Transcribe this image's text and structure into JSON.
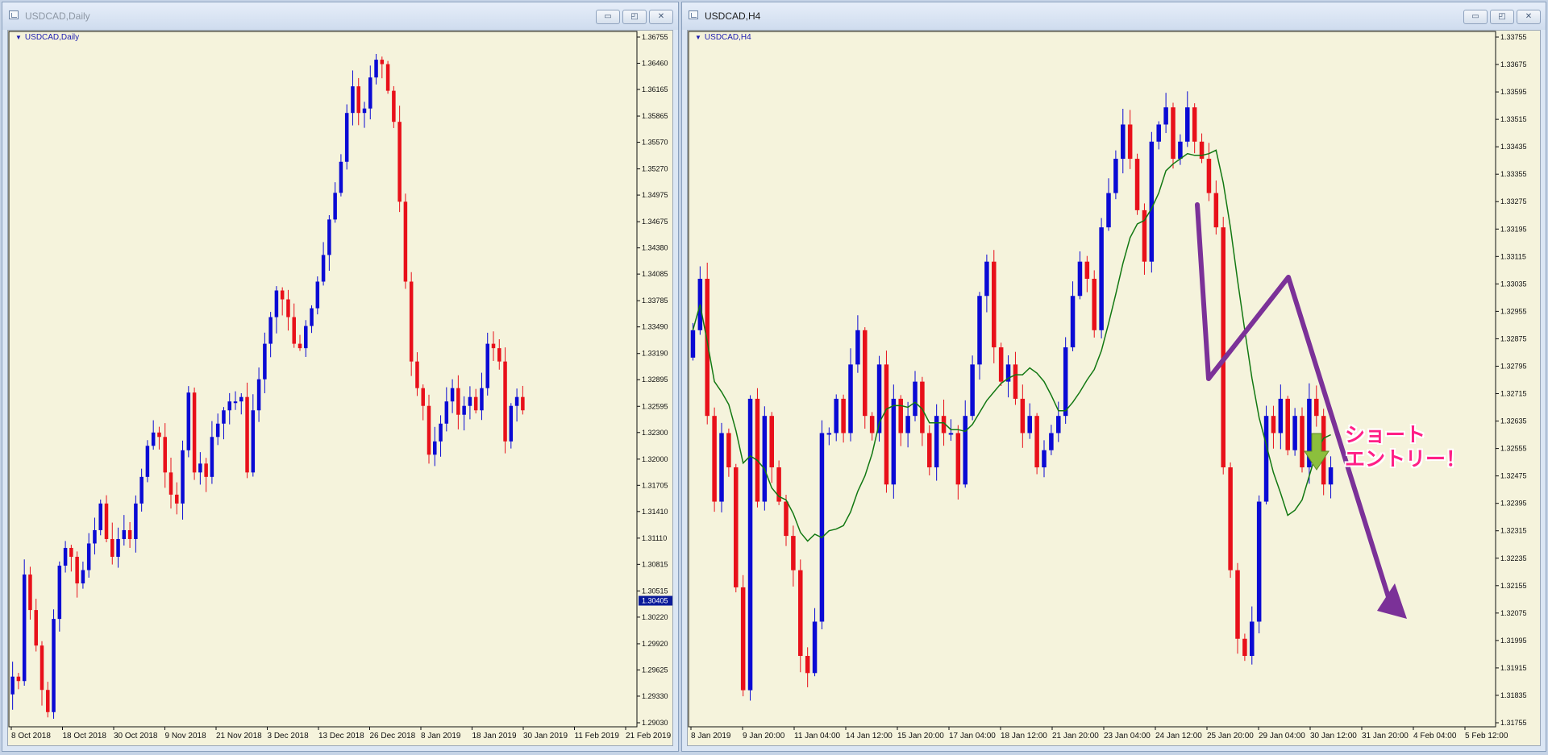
{
  "windows": [
    {
      "title": "USDCAD,Daily",
      "chart_label": "USDCAD,Daily",
      "buttons": {
        "minimize": "▭",
        "restore": "◰",
        "close": "✕"
      }
    },
    {
      "title": "USDCAD,H4",
      "chart_label": "USDCAD,H4",
      "buttons": {
        "minimize": "▭",
        "restore": "◰",
        "close": "✕"
      }
    }
  ],
  "colors": {
    "background": "#f5f3dc",
    "bull": "#0a0ad4",
    "bear": "#e8101a",
    "moving_average": "#127812",
    "annotation_arrow": "#7b3198",
    "entry_arrow": "#8cbf3c",
    "annotation_text": "#ff1f86"
  },
  "annotation": {
    "lines": [
      "ショート",
      "エントリー！"
    ],
    "icon": "down-arrow-icon"
  },
  "chart_data": [
    {
      "type": "candlestick",
      "symbol": "USDCAD",
      "timeframe": "Daily",
      "ylim": [
        1.2903,
        1.36755
      ],
      "y_ticks": [
        "1.36755",
        "1.36460",
        "1.36165",
        "1.35865",
        "1.35570",
        "1.35270",
        "1.34975",
        "1.34675",
        "1.34380",
        "1.34085",
        "1.33785",
        "1.33490",
        "1.33190",
        "1.32895",
        "1.32595",
        "1.32300",
        "1.32000",
        "1.31705",
        "1.31410",
        "1.31110",
        "1.30815",
        "1.30515",
        "1.30220",
        "1.29920",
        "1.29625",
        "1.29330",
        "1.29030"
      ],
      "current_price": "1.30405",
      "x_labels": [
        "8 Oct 2018",
        "18 Oct 2018",
        "30 Oct 2018",
        "9 Nov 2018",
        "21 Nov 2018",
        "3 Dec 2018",
        "13 Dec 2018",
        "26 Dec 2018",
        "8 Jan 2019",
        "18 Jan 2019",
        "30 Jan 2019",
        "11 Feb 2019",
        "21 Feb 2019"
      ],
      "closes": [
        1.2955,
        1.295,
        1.307,
        1.303,
        1.299,
        1.294,
        1.2915,
        1.302,
        1.308,
        1.31,
        1.309,
        1.306,
        1.3075,
        1.3105,
        1.312,
        1.315,
        1.311,
        1.309,
        1.311,
        1.312,
        1.311,
        1.315,
        1.318,
        1.3215,
        1.323,
        1.3225,
        1.3185,
        1.316,
        1.315,
        1.321,
        1.3275,
        1.3185,
        1.3195,
        1.318,
        1.3225,
        1.324,
        1.3255,
        1.3265,
        1.3265,
        1.327,
        1.3185,
        1.3255,
        1.329,
        1.333,
        1.336,
        1.339,
        1.338,
        1.336,
        1.333,
        1.3325,
        1.335,
        1.337,
        1.34,
        1.343,
        1.347,
        1.35,
        1.3535,
        1.359,
        1.362,
        1.359,
        1.3595,
        1.363,
        1.365,
        1.3645,
        1.3615,
        1.358,
        1.349,
        1.34,
        1.331,
        1.328,
        1.326,
        1.3205,
        1.322,
        1.324,
        1.3265,
        1.328,
        1.325,
        1.326,
        1.327,
        1.3255,
        1.328,
        1.333,
        1.3325,
        1.331,
        1.322,
        1.326,
        1.327,
        1.3255
      ],
      "indicator": null
    },
    {
      "type": "candlestick",
      "symbol": "USDCAD",
      "timeframe": "H4",
      "ylim": [
        1.31755,
        1.33755
      ],
      "y_ticks": [
        "1.33755",
        "1.33675",
        "1.33595",
        "1.33515",
        "1.33435",
        "1.33355",
        "1.33275",
        "1.33195",
        "1.33115",
        "1.33035",
        "1.32955",
        "1.32875",
        "1.32795",
        "1.32715",
        "1.32635",
        "1.32555",
        "1.32475",
        "1.32395",
        "1.32315",
        "1.32235",
        "1.32155",
        "1.32075",
        "1.31995",
        "1.31915",
        "1.31835",
        "1.31755"
      ],
      "x_labels": [
        "8 Jan 2019",
        "9 Jan 20:00",
        "11 Jan 04:00",
        "14 Jan 12:00",
        "15 Jan 20:00",
        "17 Jan 04:00",
        "18 Jan 12:00",
        "21 Jan 20:00",
        "23 Jan 04:00",
        "24 Jan 12:00",
        "25 Jan 20:00",
        "29 Jan 04:00",
        "30 Jan 12:00",
        "31 Jan 20:00",
        "4 Feb 04:00",
        "5 Feb 12:00"
      ],
      "closes": [
        1.329,
        1.3305,
        1.3265,
        1.324,
        1.326,
        1.325,
        1.3215,
        1.3185,
        1.327,
        1.324,
        1.3265,
        1.325,
        1.324,
        1.323,
        1.322,
        1.3195,
        1.319,
        1.3205,
        1.326,
        1.326,
        1.327,
        1.326,
        1.328,
        1.329,
        1.3265,
        1.326,
        1.328,
        1.3245,
        1.327,
        1.326,
        1.3265,
        1.3275,
        1.326,
        1.325,
        1.3265,
        1.326,
        1.326,
        1.3245,
        1.3265,
        1.328,
        1.33,
        1.331,
        1.3285,
        1.3275,
        1.328,
        1.327,
        1.326,
        1.3265,
        1.325,
        1.3255,
        1.326,
        1.3265,
        1.3285,
        1.33,
        1.331,
        1.3305,
        1.329,
        1.332,
        1.333,
        1.334,
        1.335,
        1.334,
        1.3325,
        1.331,
        1.3345,
        1.335,
        1.3355,
        1.334,
        1.3345,
        1.3355,
        1.3345,
        1.334,
        1.333,
        1.332,
        1.325,
        1.322,
        1.32,
        1.3195,
        1.3205,
        1.324,
        1.3265,
        1.326,
        1.327,
        1.3255,
        1.3265,
        1.325,
        1.327,
        1.3265,
        1.3245,
        1.325
      ],
      "indicator": {
        "name": "",
        "type": "moving average"
      }
    }
  ]
}
